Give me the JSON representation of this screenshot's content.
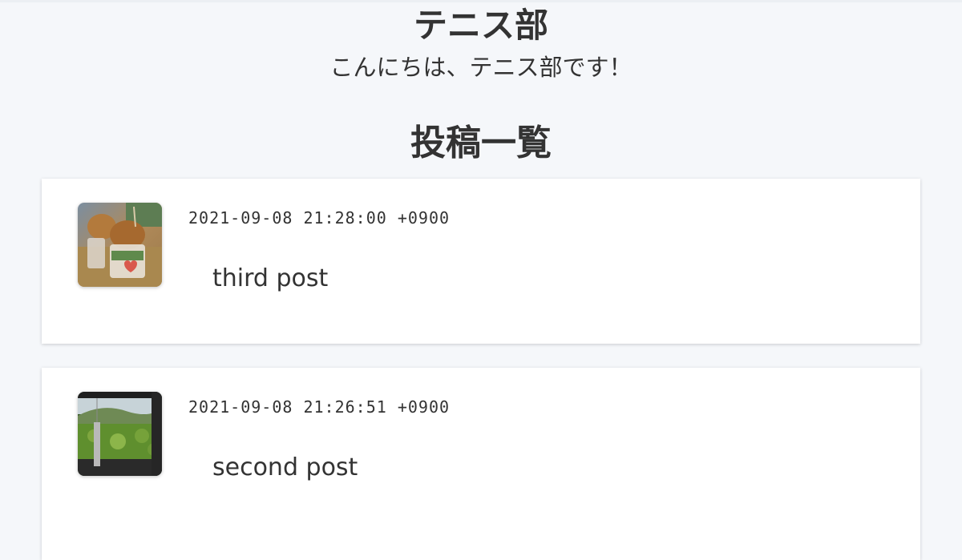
{
  "club": {
    "title": "テニス部",
    "greeting": "こんにちは、テニス部です！"
  },
  "posts_section": {
    "title": "投稿一覧"
  },
  "posts": [
    {
      "date": "2021-09-08 21:28:00 +0900",
      "body": "third post"
    },
    {
      "date": "2021-09-08 21:26:51 +0900",
      "body": "second post"
    }
  ],
  "colors": {
    "background": "#f5f7fa",
    "card": "#ffffff",
    "text": "#333333"
  }
}
